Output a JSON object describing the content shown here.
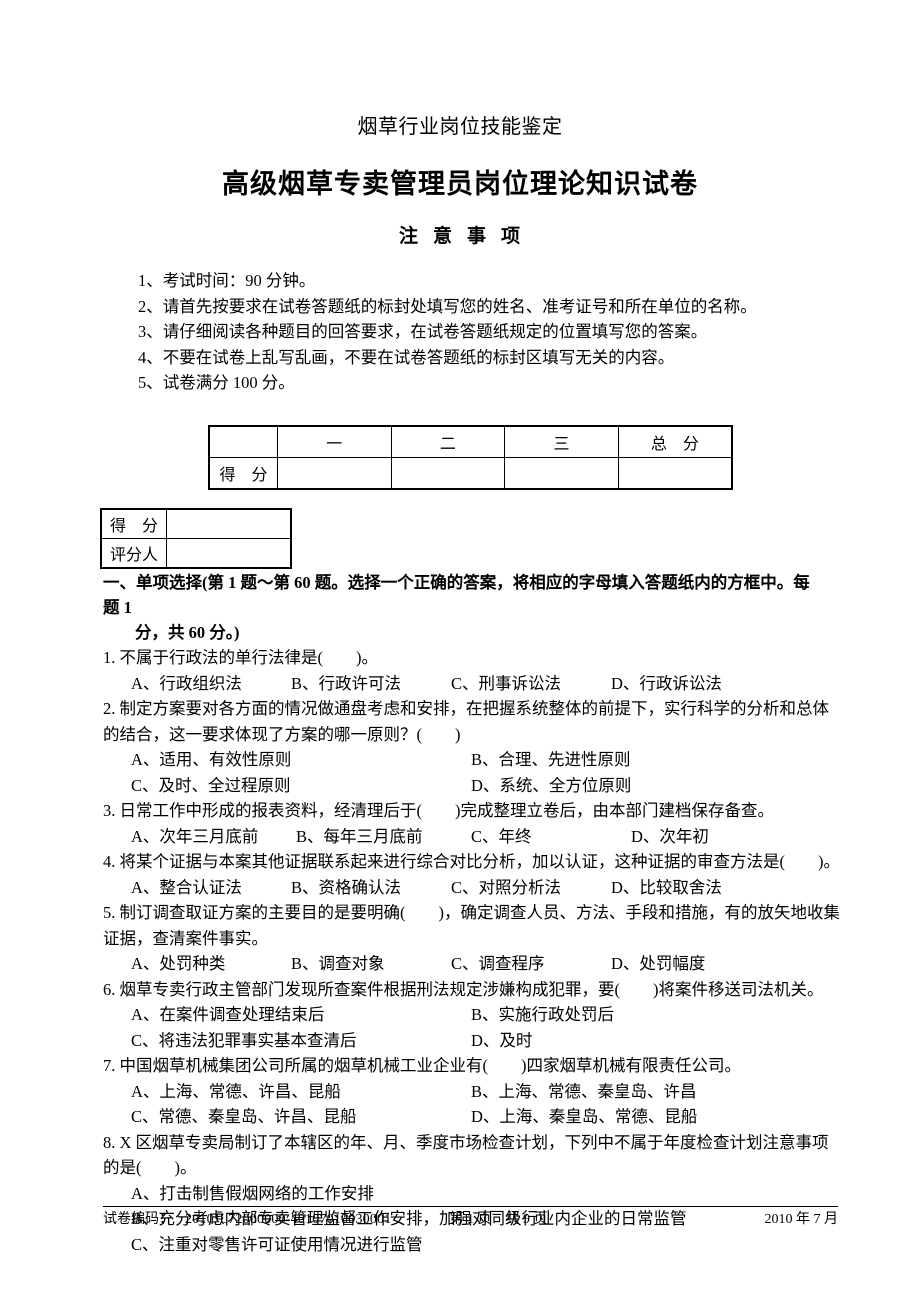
{
  "header": {
    "line1": "烟草行业岗位技能鉴定",
    "line2": "高级烟草专卖管理员岗位理论知识试卷",
    "notice_title_chars": [
      "注",
      "意",
      "事",
      "项"
    ]
  },
  "notice": {
    "items": [
      "1、考试时间：90 分钟。",
      "2、请首先按要求在试卷答题纸的标封处填写您的姓名、准考证号和所在单位的名称。",
      "3、请仔细阅读各种题目的回答要求，在试卷答题纸规定的位置填写您的答案。",
      "4、不要在试卷上乱写乱画，不要在试卷答题纸的标封区填写无关的内容。",
      "5、试卷满分 100 分。"
    ]
  },
  "score_table": {
    "corner": "",
    "columns": [
      "一",
      "二",
      "三",
      "总　分"
    ],
    "row_label": "得　分",
    "cells": [
      "",
      "",
      "",
      ""
    ]
  },
  "grader_table": {
    "rows": [
      {
        "label": "得　分",
        "value": ""
      },
      {
        "label": "评分人",
        "value": ""
      }
    ]
  },
  "section": {
    "heading_line1": "一、单项选择(第 1 题～第 60 题。选择一个正确的答案，将相应的字母填入答题纸内的方框中。每题 1",
    "heading_line2": "分，共 60 分。)"
  },
  "questions": [
    {
      "number": "1.",
      "stem_line1": "不属于行政法的单行法律是(　　)。",
      "stem_line2": "",
      "layout": "cols4",
      "options": [
        "A、行政组织法",
        "B、行政许可法",
        "C、刑事诉讼法",
        "D、行政诉讼法"
      ]
    },
    {
      "number": "2.",
      "stem_line1": "制定方案要对各方面的情况做通盘考虑和安排，在把握系统整体的前提下，实行科学的分析和总体",
      "stem_line2": "的结合，这一要求体现了方案的哪一原则？(　　)",
      "layout": "cols2",
      "options": [
        "A、适用、有效性原则",
        "B、合理、先进性原则",
        "C、及时、全过程原则",
        "D、系统、全方位原则"
      ]
    },
    {
      "number": "3.",
      "stem_line1": "日常工作中形成的报表资料，经清理后于(　　)完成整理立卷后，由本部门建档保存备查。",
      "stem_line2": "",
      "layout": "w4a",
      "options": [
        "A、次年三月底前",
        "B、每年三月底前",
        "C、年终",
        "D、次年初"
      ]
    },
    {
      "number": "4.",
      "stem_line1": "将某个证据与本案其他证据联系起来进行综合对比分析，加以认证，这种证据的审查方法是(　　)。",
      "stem_line2": "",
      "layout": "cols4",
      "options": [
        "A、整合认证法",
        "B、资格确认法",
        "C、对照分析法",
        "D、比较取舍法"
      ]
    },
    {
      "number": "5.",
      "stem_line1": "制订调查取证方案的主要目的是要明确(　　)，确定调查人员、方法、手段和措施，有的放矢地收集",
      "stem_line2": "证据，查清案件事实。",
      "layout": "cols4",
      "options": [
        "A、处罚种类",
        "B、调查对象",
        "C、调查程序",
        "D、处罚幅度"
      ]
    },
    {
      "number": "6.",
      "stem_line1": "烟草专卖行政主管部门发现所查案件根据刑法规定涉嫌构成犯罪，要(　　)将案件移送司法机关。",
      "stem_line2": "",
      "layout": "cols2",
      "options": [
        "A、在案件调查处理结束后",
        "B、实施行政处罚后",
        "C、将违法犯罪事实基本查清后",
        "D、及时"
      ]
    },
    {
      "number": "7.",
      "stem_line1": "中国烟草机械集团公司所属的烟草机械工业企业有(　　)四家烟草机械有限责任公司。",
      "stem_line2": "",
      "layout": "cols2",
      "options": [
        "A、上海、常德、许昌、昆船",
        "B、上海、常德、秦皇岛、许昌",
        "C、常德、秦皇岛、许昌、昆船",
        "D、上海、秦皇岛、常德、昆船"
      ]
    },
    {
      "number": "8.",
      "stem_line1": "X 区烟草专卖局制订了本辖区的年、月、季度市场检查计划，下列中不属于年度检查计划注意事项",
      "stem_line2": "的是(　　)。",
      "layout": "stack",
      "options": [
        "A、打击制售假烟网络的工作安排",
        "B、充分考虑内部专卖管理监督工作安排，加强对同级行业内企业的日常监管",
        "C、注重对零售许可证使用情况进行监管"
      ]
    }
  ],
  "footer": {
    "code_label": "试卷编码：",
    "code_value": "2010JL72000000-40107010030001",
    "pages": "第 1 页　共 9 页",
    "date": "2010 年 7 月"
  }
}
